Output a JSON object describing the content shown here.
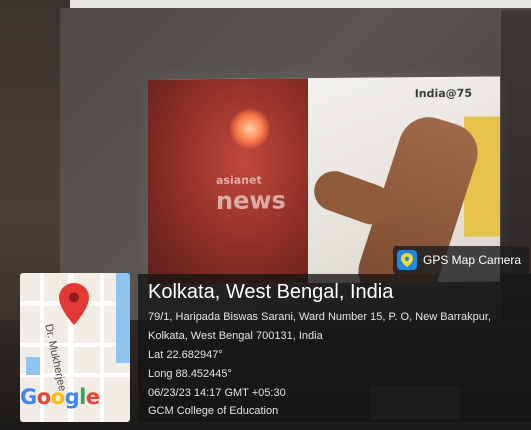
{
  "projection": {
    "logo_line1": "asianet",
    "logo_line2": "news",
    "badge": "India@75"
  },
  "gps_tag": {
    "label": "GPS Map Camera",
    "icon": "map-pin-icon"
  },
  "map": {
    "street_label": "Dr. Mukherjee",
    "google_letters": [
      "G",
      "o",
      "o",
      "g",
      "l",
      "e"
    ],
    "google_colors": [
      "#4285F4",
      "#EA4335",
      "#FBBC05",
      "#4285F4",
      "#34A853",
      "#EA4335"
    ],
    "pin_color": "#e53935",
    "water_color": "#8fc3f0"
  },
  "location": {
    "title": "Kolkata, West Bengal, India",
    "address_line1": "79/1, Haripada Biswas Sarani, Ward Number 15, P. O, New Barrakpur,",
    "address_line2": "Kolkata, West Bengal 700131, India",
    "lat": "Lat 22.682947°",
    "long": "Long 88.452445°",
    "datetime": "06/23/23 14:17 GMT +05:30",
    "note": "GCM College of Education"
  }
}
